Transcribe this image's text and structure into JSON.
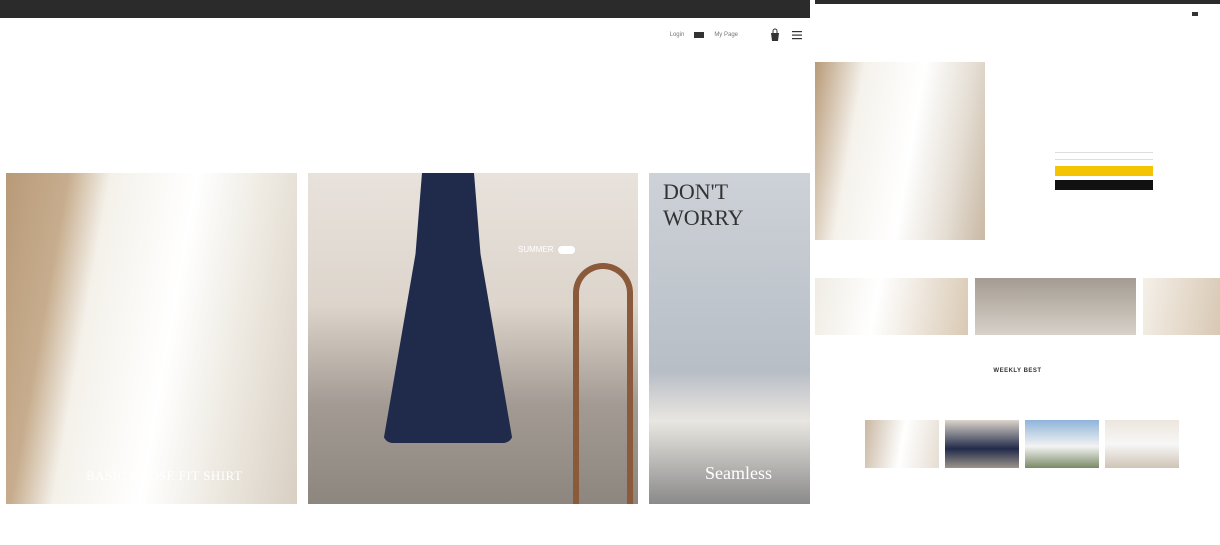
{
  "left": {
    "topbar_text": "",
    "util": {
      "login": "Login",
      "join": "",
      "mypage": "My Page",
      "order": "",
      "cs": ""
    },
    "nav": [
      "",
      "",
      "",
      "",
      "",
      "",
      "",
      "",
      "",
      "",
      "",
      "",
      "",
      "",
      "",
      "",
      "",
      "",
      "",
      ""
    ],
    "slides": {
      "shirt_text": "BASIC LOOSE FIT SHIRT",
      "summer_label": "SUMMER",
      "worry_text": "DON'T WORRY",
      "seamless_text": "Seamless"
    }
  },
  "right": {
    "util": [
      "",
      "",
      "",
      "",
      ""
    ],
    "product": {
      "name": "",
      "price": ""
    },
    "buy_label": "",
    "cart_label": "",
    "weekly_best_title": "WEEKLY BEST",
    "weekly_items": [
      {
        "name": "",
        "price": ""
      },
      {
        "name": "",
        "price": ""
      },
      {
        "name": "",
        "price": ""
      },
      {
        "name": "",
        "price": ""
      }
    ]
  },
  "colors": {
    "brand": "#e2432e",
    "topbar": "#2b2b2b",
    "buy_button": "#f5c400",
    "accent_blue": "#3a63c7"
  }
}
